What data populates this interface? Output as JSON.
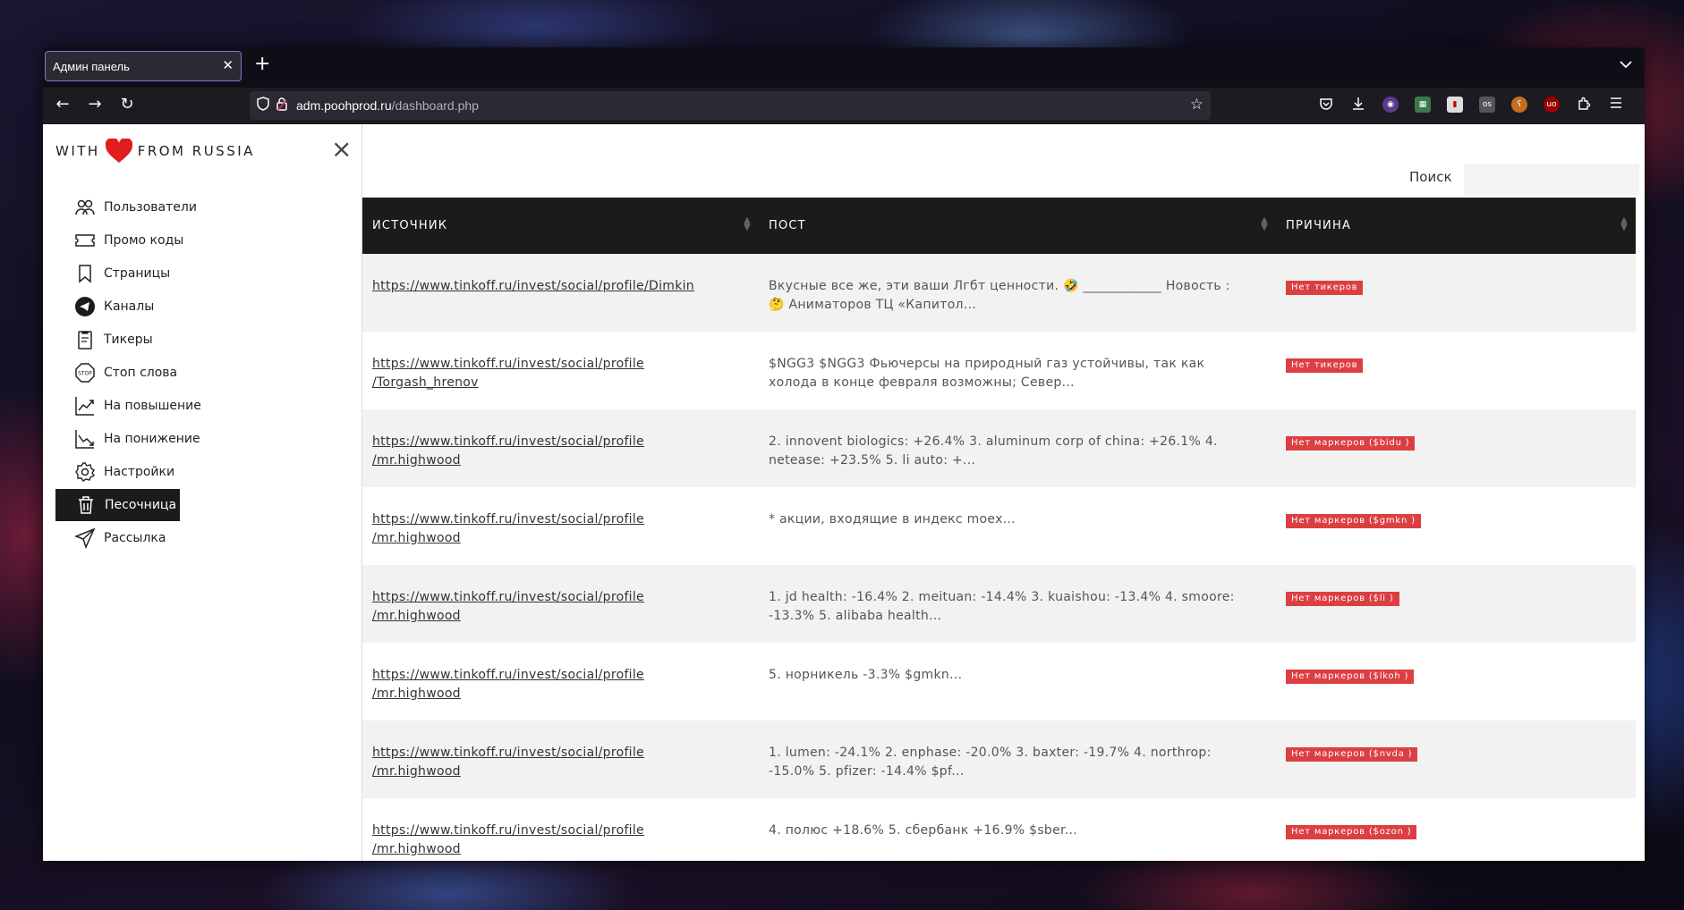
{
  "browser": {
    "tab_title": "Админ панель",
    "url_host": "adm.poohprod.ru",
    "url_path": "/dashboard.php"
  },
  "sidebar": {
    "logo_left": "WITH",
    "logo_right": "FROM RUSSIA",
    "items": [
      {
        "label": "Пользователи",
        "icon": "users-icon"
      },
      {
        "label": "Промо коды",
        "icon": "ticket-icon"
      },
      {
        "label": "Страницы",
        "icon": "bookmark-icon"
      },
      {
        "label": "Каналы",
        "icon": "telegram-icon"
      },
      {
        "label": "Тикеры",
        "icon": "clipboard-icon"
      },
      {
        "label": "Стоп слова",
        "icon": "stop-icon"
      },
      {
        "label": "На повышение",
        "icon": "trend-up-icon"
      },
      {
        "label": "На понижение",
        "icon": "trend-down-icon"
      },
      {
        "label": "Настройки",
        "icon": "gear-icon"
      },
      {
        "label": "Песочница",
        "icon": "trash-icon",
        "active": true
      },
      {
        "label": "Рассылка",
        "icon": "send-icon"
      }
    ]
  },
  "search": {
    "label": "Поиск",
    "value": ""
  },
  "table": {
    "headers": [
      "ИСТОЧНИК",
      "ПОСТ",
      "ПРИЧИНА"
    ],
    "rows": [
      {
        "source_1": "https://www.tinkoff.ru/invest/social/profile/Dimkin",
        "source_2": "",
        "post_1": "Вкусные все же, эти ваши Лгбт ценности. 🤣 ____________ Новость :",
        "post_2": "🤔 Аниматоров ТЦ «Капитол...",
        "reason": "Нет тикеров"
      },
      {
        "source_1": "https://www.tinkoff.ru/invest/social/profile",
        "source_2": "/Torgash_hrenov",
        "post_1": "$NGG3 $NGG3 Фьючерсы на природный газ устойчивы, так как",
        "post_2": "холода в конце февраля возможны; Север...",
        "reason": "Нет тикеров"
      },
      {
        "source_1": "https://www.tinkoff.ru/invest/social/profile",
        "source_2": "/mr.highwood",
        "post_1": "2. innovent biologics: +26.4% 3. aluminum corp of china: +26.1% 4.",
        "post_2": "netease: +23.5% 5. li auto: +...",
        "reason": "Нет маркеров ($bidu )"
      },
      {
        "source_1": "https://www.tinkoff.ru/invest/social/profile",
        "source_2": "/mr.highwood",
        "post_1": "* акции, входящие в индекс moex...",
        "post_2": "",
        "reason": "Нет маркеров ($gmkn )"
      },
      {
        "source_1": "https://www.tinkoff.ru/invest/social/profile",
        "source_2": "/mr.highwood",
        "post_1": "1. jd health: -16.4% 2. meituan: -14.4% 3. kuaishou: -13.4% 4. smoore:",
        "post_2": "-13.3% 5. alibaba health...",
        "reason": "Нет маркеров ($li )"
      },
      {
        "source_1": "https://www.tinkoff.ru/invest/social/profile",
        "source_2": "/mr.highwood",
        "post_1": "5. норникель -3.3% $gmkn...",
        "post_2": "",
        "reason": "Нет маркеров ($lkoh )"
      },
      {
        "source_1": "https://www.tinkoff.ru/invest/social/profile",
        "source_2": "/mr.highwood",
        "post_1": "1. lumen: -24.1% 2. enphase: -20.0% 3. baxter: -19.7% 4. northrop:",
        "post_2": "-15.0% 5. pfizer: -14.4% $pf...",
        "reason": "Нет маркеров ($nvda )"
      },
      {
        "source_1": "https://www.tinkoff.ru/invest/social/profile",
        "source_2": "/mr.highwood",
        "post_1": "4. полюс +18.6% 5. сбербанк +16.9% $sber...",
        "post_2": "",
        "reason": "Нет маркеров ($ozon )"
      }
    ]
  },
  "colors": {
    "accent": "#dc3f42",
    "header_bg": "#1b1b1b",
    "heart": "#e11d1d"
  }
}
